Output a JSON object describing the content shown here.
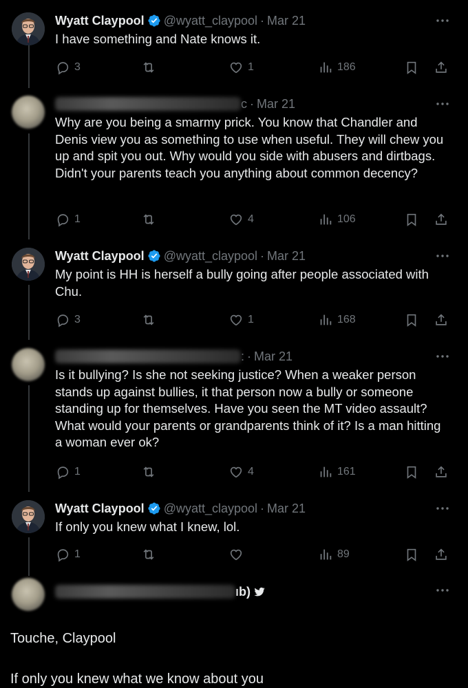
{
  "tweets": [
    {
      "name": "Wyatt Claypool",
      "handle": "@wyatt_claypool",
      "date": "Mar 21",
      "text": "I have something and Nate knows it.",
      "replies": "3",
      "retweets": "",
      "likes": "1",
      "views": "186"
    },
    {
      "name_fragment": "c",
      "date": "Mar 21",
      "text": "Why are you being a smarmy prick. You know that Chandler and Denis view you as something to use when useful. They will chew you up and spit you out. Why would you side with abusers and dirtbags. Didn't your parents teach you anything about common decency?",
      "replies": "1",
      "retweets": "",
      "likes": "4",
      "views": "106"
    },
    {
      "name": "Wyatt Claypool",
      "handle": "@wyatt_claypool",
      "date": "Mar 21",
      "text": "My point is HH is herself a bully going after people associated with Chu.",
      "replies": "3",
      "retweets": "",
      "likes": "1",
      "views": "168"
    },
    {
      "name_fragment": ":",
      "date": "Mar 21",
      "text": "Is it bullying? Is she not seeking justice? When a weaker person stands up against bullies, it that person now a bully or someone standing up for themselves. Have you seen the MT video assault? What would your parents or grandparents think of it? Is a man hitting a woman ever ok?",
      "replies": "1",
      "retweets": "",
      "likes": "4",
      "views": "161"
    },
    {
      "name": "Wyatt Claypool",
      "handle": "@wyatt_claypool",
      "date": "Mar 21",
      "text": "If only you knew what I knew, lol.",
      "replies": "1",
      "retweets": "",
      "likes": "",
      "views": "89"
    }
  ],
  "final_tweet": {
    "name_fragment": "ıb)",
    "line1": "Touche, Claypool",
    "line2": "If only you knew what we know about you"
  },
  "icons": {
    "reply": "reply-icon",
    "retweet": "retweet-icon",
    "like": "heart-icon",
    "views": "views-icon",
    "bookmark": "bookmark-icon",
    "share": "share-icon",
    "more": "more-icon",
    "verified": "verified-badge-icon",
    "bird": "twitter-bird-icon"
  },
  "colors": {
    "background": "#000000",
    "text": "#e7e9ea",
    "secondary": "#71767b",
    "verified": "#1d9bf0",
    "thread_line": "#333639"
  }
}
